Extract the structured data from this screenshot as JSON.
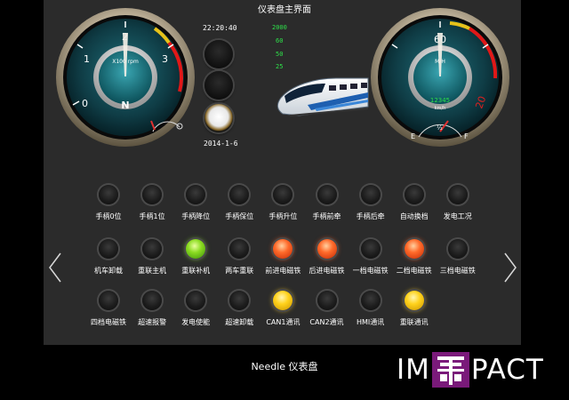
{
  "title": "仪表盘主界面",
  "time": "22:20:40",
  "date": "2014-1-6",
  "readouts": [
    "2000",
    "60",
    "50",
    "25"
  ],
  "rpm_gauge": {
    "ticks": [
      "0",
      "1",
      "2",
      "3"
    ],
    "unit": "X100 rpm",
    "gear": "N"
  },
  "speed_gauge": {
    "ticks": [
      "60",
      "20"
    ],
    "unit": "M/H",
    "odometer": "12345",
    "odometer_unit": "km/h",
    "fuel_left": "E",
    "fuel_half": "½",
    "fuel_right": "F"
  },
  "lamps": [
    [
      {
        "label": "手柄0位",
        "state": "off"
      },
      {
        "label": "手柄1位",
        "state": "off"
      },
      {
        "label": "手柄降位",
        "state": "off"
      },
      {
        "label": "手柄保位",
        "state": "off"
      },
      {
        "label": "手柄升位",
        "state": "off"
      },
      {
        "label": "手柄前牵",
        "state": "off"
      },
      {
        "label": "手柄后牵",
        "state": "off"
      },
      {
        "label": "自动换档",
        "state": "off"
      },
      {
        "label": "发电工况",
        "state": "off"
      }
    ],
    [
      {
        "label": "机车卸载",
        "state": "off"
      },
      {
        "label": "重联主机",
        "state": "off"
      },
      {
        "label": "重联补机",
        "state": "green"
      },
      {
        "label": "两车重联",
        "state": "off"
      },
      {
        "label": "前进电磁铁",
        "state": "red"
      },
      {
        "label": "后进电磁铁",
        "state": "red"
      },
      {
        "label": "一档电磁铁",
        "state": "off"
      },
      {
        "label": "二档电磁铁",
        "state": "red"
      },
      {
        "label": "三档电磁铁",
        "state": "off"
      }
    ],
    [
      {
        "label": "四档电磁铁",
        "state": "off"
      },
      {
        "label": "超速报警",
        "state": "off"
      },
      {
        "label": "发电使能",
        "state": "off"
      },
      {
        "label": "超速卸载",
        "state": "off"
      },
      {
        "label": "CAN1通讯",
        "state": "yellow"
      },
      {
        "label": "CAN2通讯",
        "state": "off"
      },
      {
        "label": "HMI通讯",
        "state": "off"
      },
      {
        "label": "重联通讯",
        "state": "yellow"
      }
    ]
  ],
  "footer": "Needle 仪表盘",
  "logo": {
    "left": "IM",
    "right": "PACT"
  }
}
